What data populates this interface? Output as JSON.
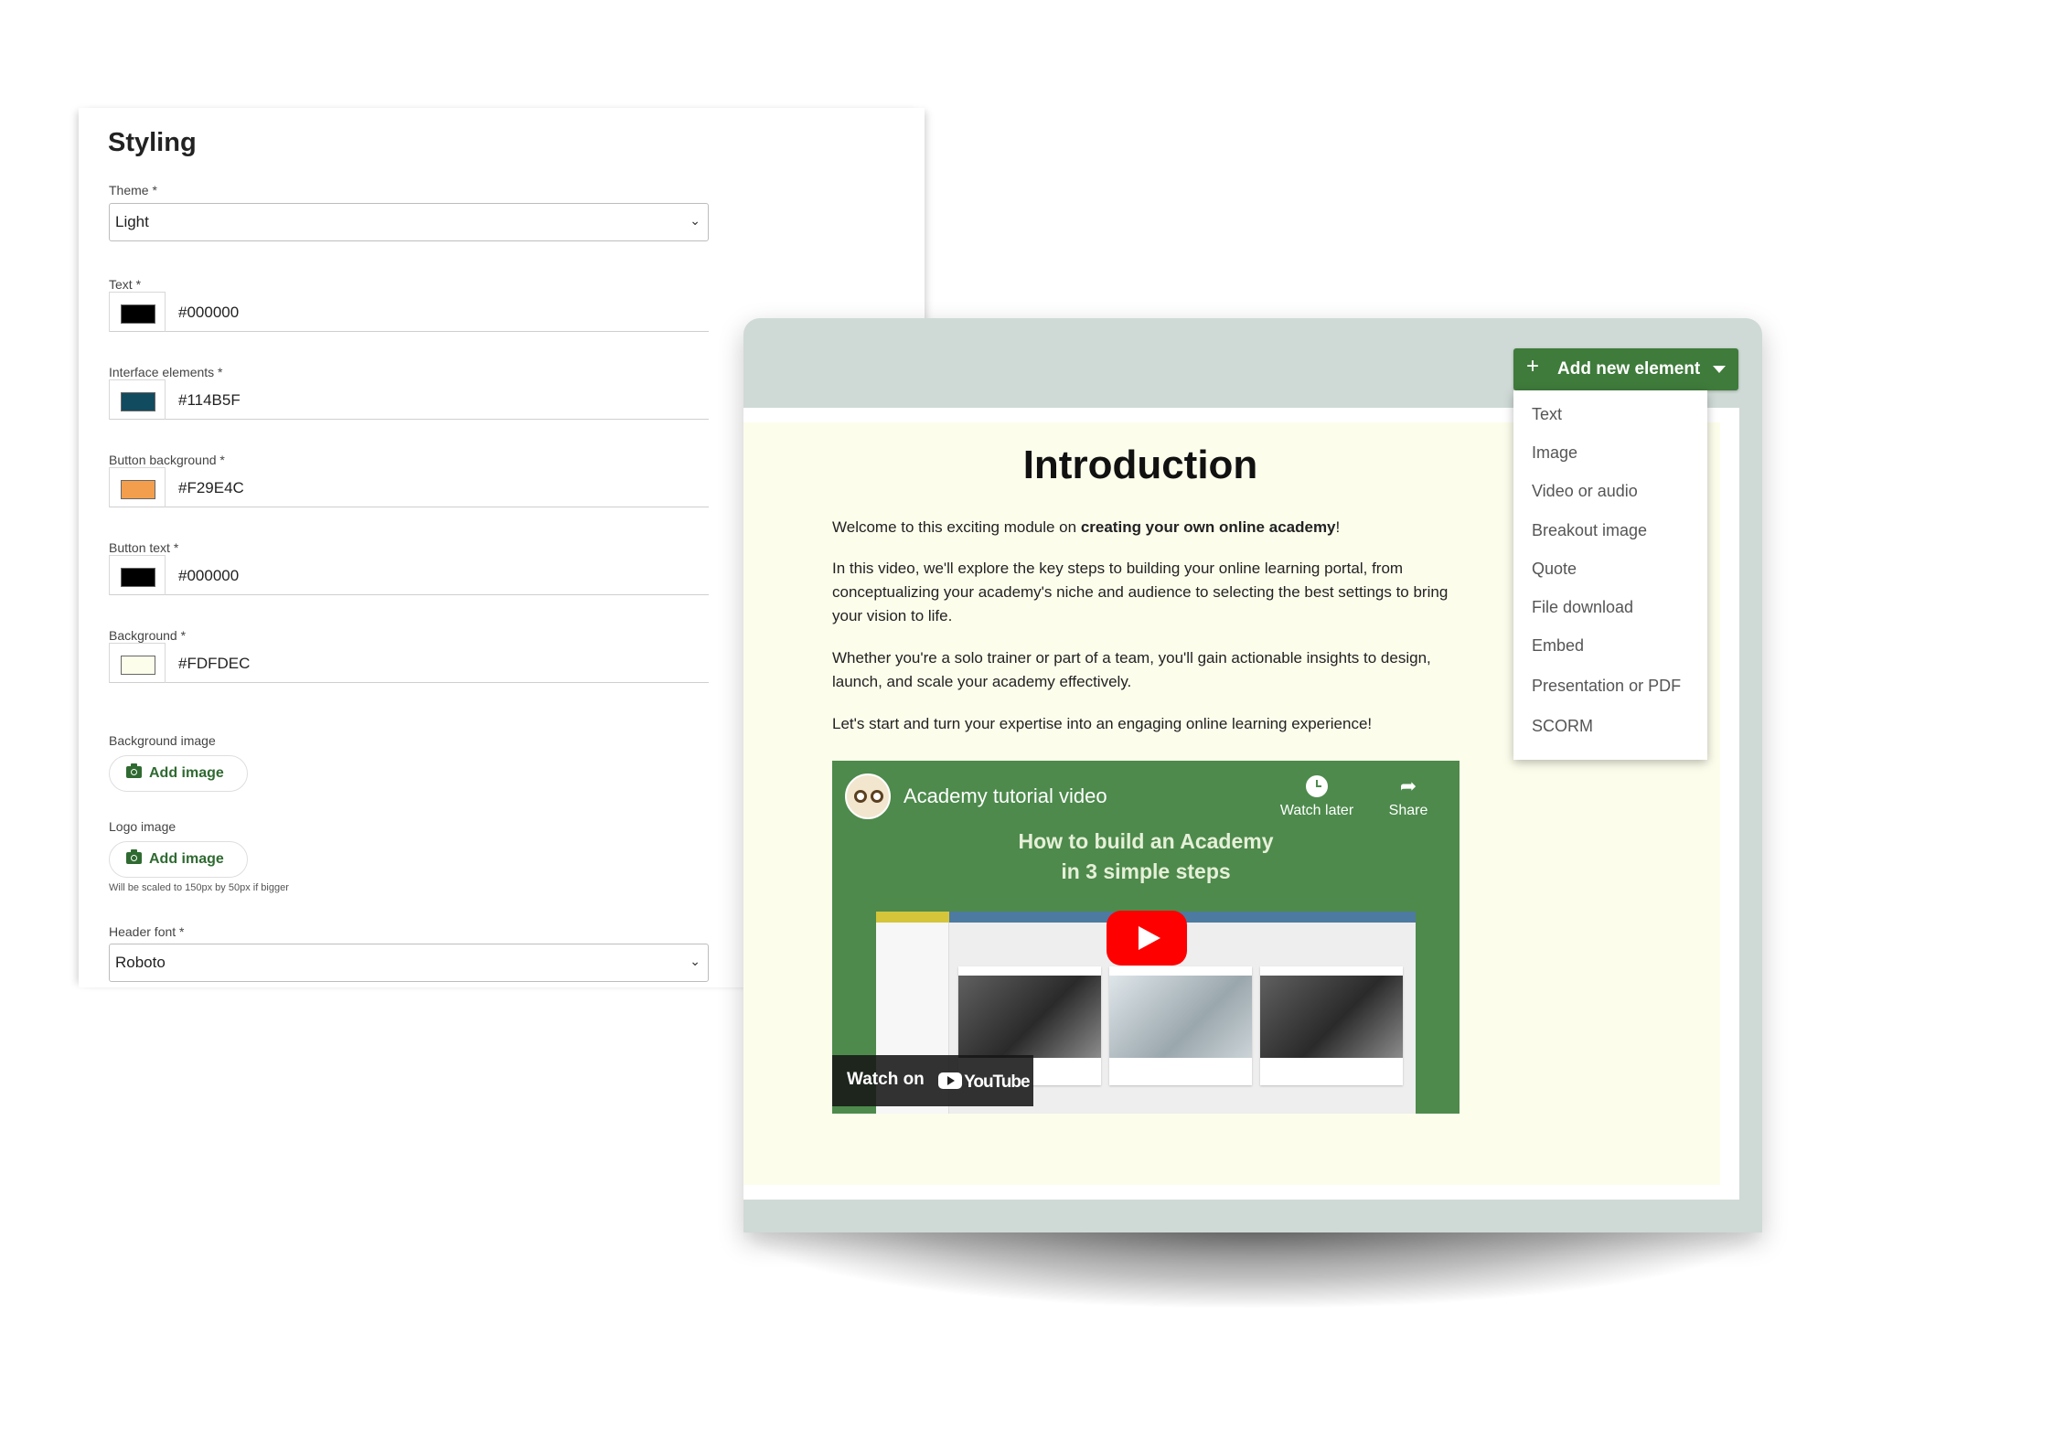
{
  "styling": {
    "title": "Styling",
    "theme": {
      "label": "Theme *",
      "value": "Light"
    },
    "colors": [
      {
        "label": "Text *",
        "value": "#000000",
        "swatch": "#000000"
      },
      {
        "label": "Interface elements *",
        "value": "#114B5F",
        "swatch": "#114B5F"
      },
      {
        "label": "Button background *",
        "value": "#F29E4C",
        "swatch": "#F29E4C"
      },
      {
        "label": "Button text *",
        "value": "#000000",
        "swatch": "#000000"
      },
      {
        "label": "Background *",
        "value": "#FDFDEC",
        "swatch": "#FDFDEC"
      }
    ],
    "background_image": {
      "label": "Background image",
      "button": "Add image"
    },
    "logo_image": {
      "label": "Logo image",
      "button": "Add image",
      "help": "Will be scaled to 150px by 50px if bigger"
    },
    "header_font": {
      "label": "Header font *",
      "value": "Roboto"
    }
  },
  "editor": {
    "title": "Introduction",
    "para1_prefix": "Welcome to this exciting module on ",
    "para1_bold": "creating your own online academy",
    "para1_suffix": "!",
    "para2": "In this video, we'll explore the key steps to building your online learning portal, from conceptualizing your academy's niche and audience to selecting the best settings to bring your vision to life.",
    "para3": "Whether you're a solo trainer or part of a team, you'll gain actionable insights to design, launch, and scale your academy effectively.",
    "para4": "Let's start and turn your expertise into an engaging online learning experience!",
    "video": {
      "title": "Academy tutorial video",
      "headline_line1": "How to build an Academy",
      "headline_line2": "in 3 simple steps",
      "watch_later": "Watch later",
      "share": "Share",
      "watch_on": "Watch on",
      "youtube": "YouTube"
    }
  },
  "add_element": {
    "button": "Add new element",
    "items": [
      "Text",
      "Image",
      "Video or audio",
      "Breakout image",
      "Quote",
      "File download",
      "Embed",
      "Presentation or PDF",
      "SCORM"
    ]
  }
}
